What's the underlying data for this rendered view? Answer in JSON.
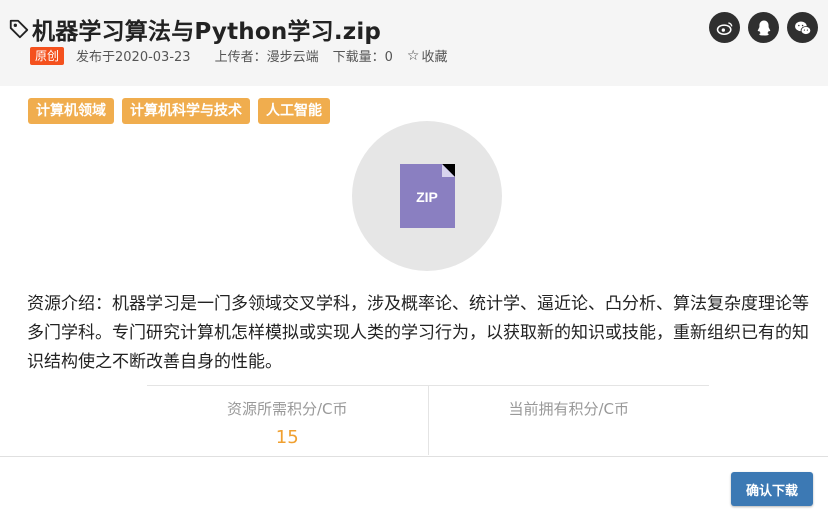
{
  "header": {
    "title": "机器学习算法与Python学习.zip",
    "badge": "原创",
    "published": "发布于2020-03-23",
    "uploader": "上传者：漫步云端",
    "downloads": "下载量：0",
    "favorite_label": "收藏",
    "share_icons": [
      "weibo-icon",
      "qq-icon",
      "wechat-icon"
    ]
  },
  "tags": [
    "计算机领域",
    "计算机科学与技术",
    "人工智能"
  ],
  "file_icon": {
    "label": "ZIP",
    "color": "#8a7fc1"
  },
  "intro": "资源介绍：机器学习是一门多领域交叉学科，涉及概率论、统计学、逼近论、凸分析、算法复杂度理论等多门学科。专门研究计算机怎样模拟或实现人类的学习行为，以获取新的知识或技能，重新组织已有的知识结构使之不断改善自身的性能。",
  "stats": {
    "required_label": "资源所需积分/C币",
    "required_value": "15",
    "owned_label": "当前拥有积分/C币",
    "owned_value": ""
  },
  "footer": {
    "confirm_label": "确认下载"
  },
  "colors": {
    "badge": "#f4511e",
    "tag": "#f0ad4e",
    "button": "#3c79b4",
    "value": "#f0a030"
  }
}
